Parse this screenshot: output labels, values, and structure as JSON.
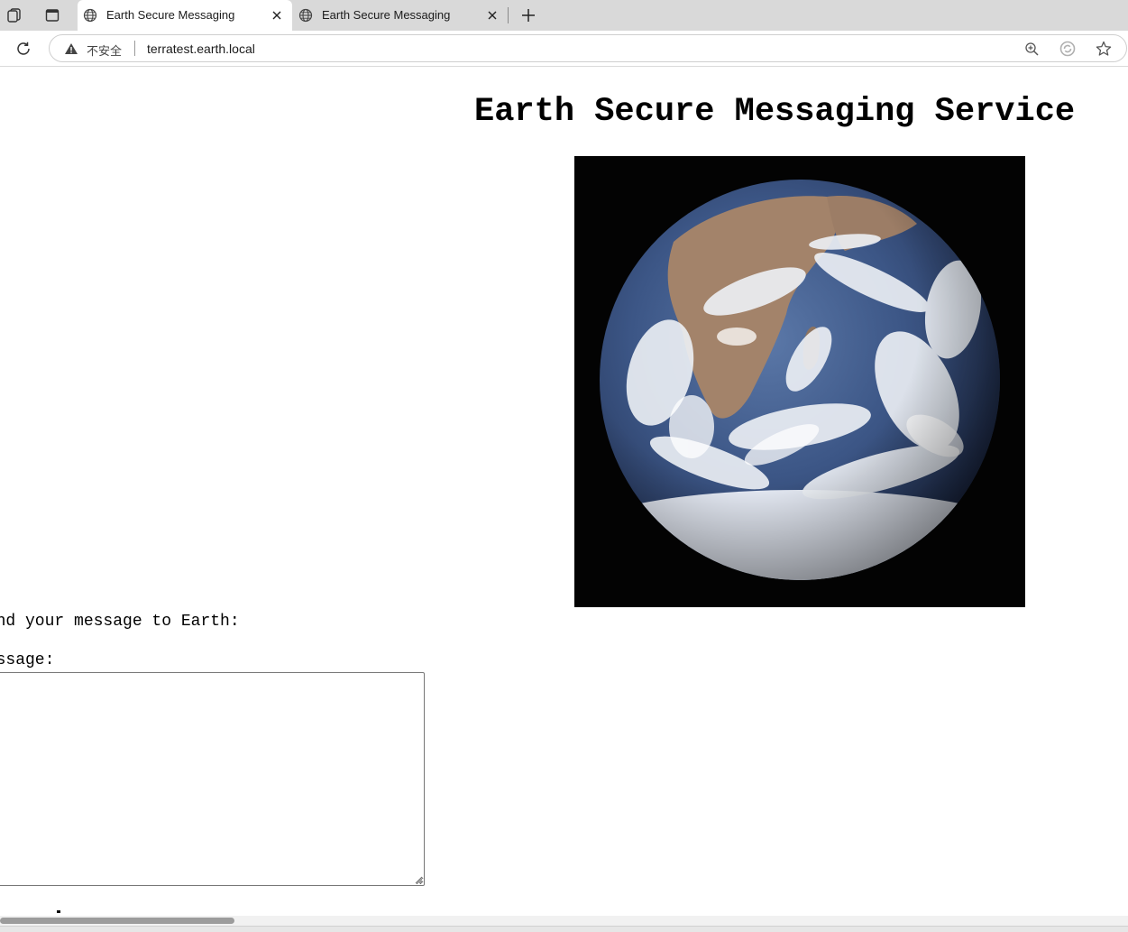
{
  "browser": {
    "tabs": [
      {
        "title": "Earth Secure Messaging",
        "active": true
      },
      {
        "title": "Earth Secure Messaging",
        "active": false
      }
    ],
    "address_bar": {
      "security_label": "不安全",
      "url": "terratest.earth.local"
    },
    "icons": {
      "workspaces": "workspaces-icon",
      "tab_actions": "tab-actions-icon",
      "globe": "globe-icon",
      "close": "close-icon",
      "new_tab": "plus-icon",
      "reload": "reload-icon",
      "warning": "warning-icon",
      "zoom": "zoom-icon",
      "read_aloud": "refresh-circle-icon",
      "favorite": "star-icon"
    }
  },
  "page": {
    "title": "Earth Secure Messaging Service",
    "image_alt": "earth-globe-photo",
    "prompt": "Send your message to Earth:",
    "message_label": "Message:",
    "message_value": ""
  },
  "colors": {
    "tabstrip": "#d9d9d9",
    "page_background": "#ffffff",
    "image_background": "#030303",
    "text": "#000000"
  }
}
